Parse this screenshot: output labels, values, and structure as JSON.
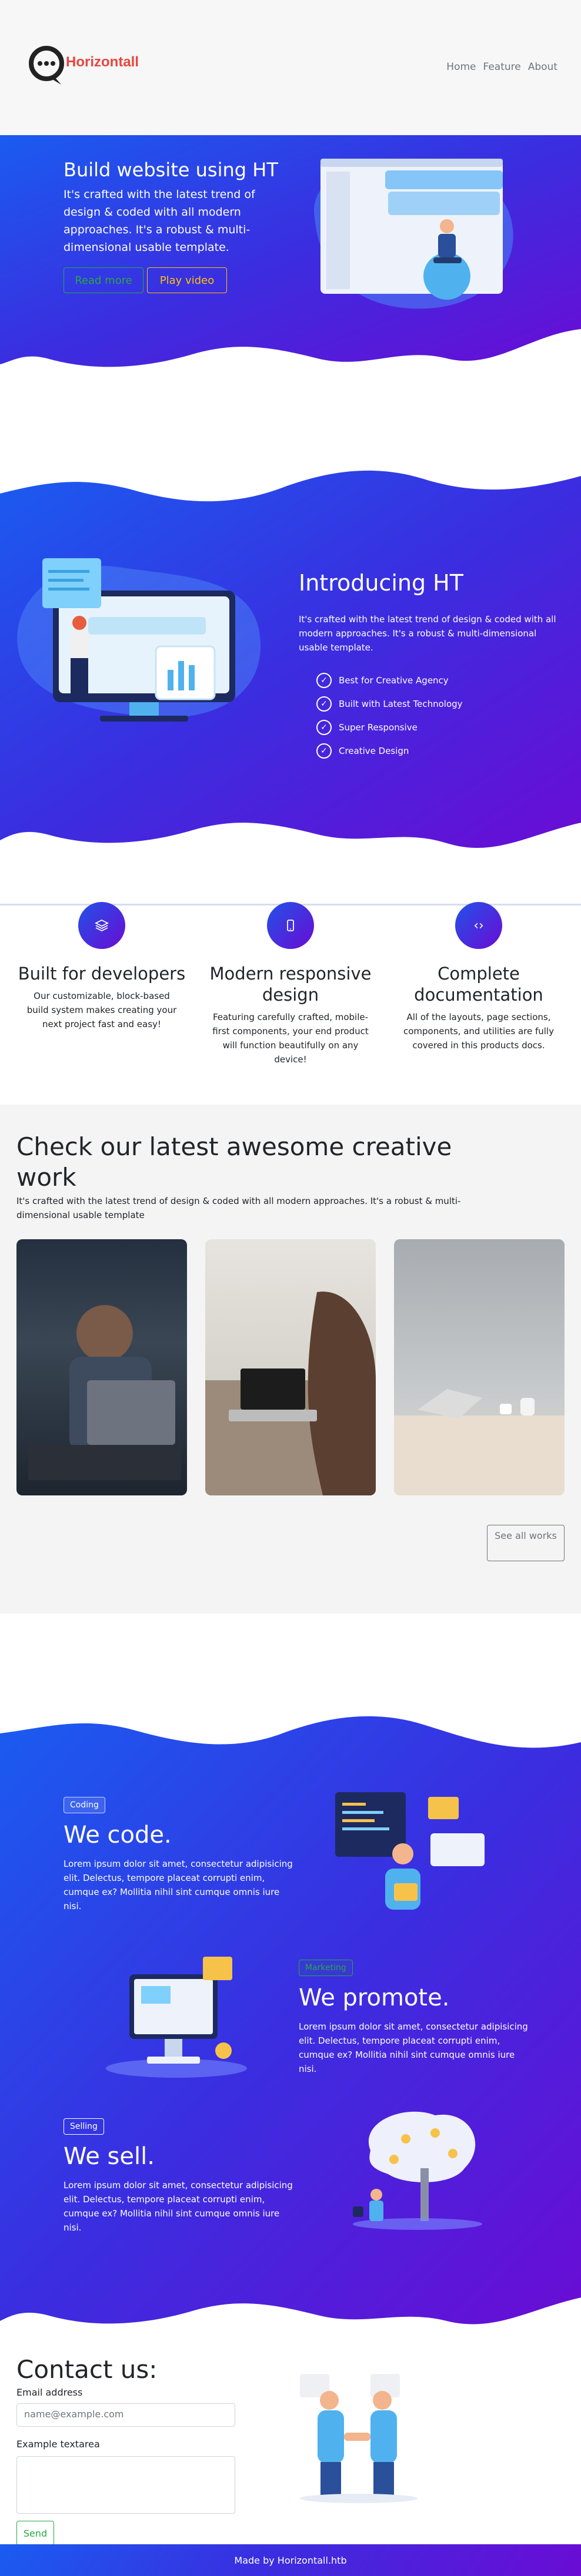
{
  "brand": {
    "name": "Horizontall"
  },
  "nav": {
    "items": [
      "Home",
      "Feature",
      "About"
    ]
  },
  "hero": {
    "title": "Build website using HT",
    "text": "It's crafted with the latest trend of design & coded with all modern approaches. It's a robust & multi-dimensional usable template.",
    "read_more": "Read more",
    "play_video": "Play video"
  },
  "intro": {
    "title": "Introducing HT",
    "text": "It's crafted with the latest trend of design & coded with all modern approaches. It's a robust & multi-dimensional usable template.",
    "checks": [
      "Best for Creative Agency",
      "Built with Latest Technology",
      "Super Responsive",
      "Creative Design"
    ]
  },
  "features": [
    {
      "icon": "layers-icon",
      "title": "Built for developers",
      "text": "Our customizable, block-based build system makes creating your next project fast and easy!"
    },
    {
      "icon": "mobile-icon",
      "title": "Modern responsive design",
      "text": "Featuring carefully crafted, mobile-first components, your end product will function beautifully on any device!"
    },
    {
      "icon": "code-icon",
      "title": "Complete documentation",
      "text": "All of the layouts, page sections, components, and utilities are fully covered in this products docs."
    }
  ],
  "works": {
    "title": "Check our latest awesome creative work",
    "text": "It's crafted with the latest trend of design & coded with all modern approaches. It's a robust & multi-dimensional usable template",
    "see_all": "See all works"
  },
  "services": [
    {
      "badge": "Coding",
      "title": "We code.",
      "text": "Lorem ipsum dolor sit amet, consectetur adipisicing elit. Delectus, tempore placeat corrupti enim, cumque ex? Mollitia nihil sint cumque omnis iure nisi."
    },
    {
      "badge": "Marketing",
      "title": "We promote.",
      "text": "Lorem ipsum dolor sit amet, consectetur adipisicing elit. Delectus, tempore placeat corrupti enim, cumque ex? Mollitia nihil sint cumque omnis iure nisi."
    },
    {
      "badge": "Selling",
      "title": "We sell.",
      "text": "Lorem ipsum dolor sit amet, consectetur adipisicing elit. Delectus, tempore placeat corrupti enim, cumque ex? Mollitia nihil sint cumque omnis iure nisi."
    }
  ],
  "contact": {
    "title": "Contact us:",
    "email_label": "Email address",
    "email_placeholder": "name@example.com",
    "textarea_label": "Example textarea",
    "send": "Send"
  },
  "footer": {
    "text": "Made by Horizontall.htb"
  },
  "colors": {
    "brand": "#e8463e",
    "gradient_start": "#1a5cf0",
    "gradient_end": "#6a0cd4",
    "success": "#28a745",
    "warning": "#ffc107"
  }
}
